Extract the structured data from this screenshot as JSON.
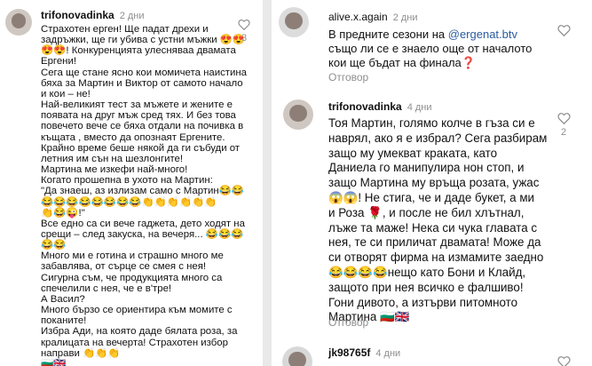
{
  "left": {
    "comment": {
      "username": "trifonovadinka",
      "time": "2 дни",
      "lines": [
        "Страхотен ерген! Ще падат дрехи и",
        "задръжки, ще ги убива с устни мъжки 😍😍",
        "😍😍! Конкуренцията улесняваа двамата",
        "Ергени!",
        "Сега ще стане ясно кои момичета наистина",
        "бяха за Мартин и Виктор от самото начало",
        "и кои – не!",
        "Най-великият тест за мъжете и жените е",
        "появата на друг мъж сред тях. И без това",
        "повечето вече се бяха отдали на почивка в",
        "къщата , вместо да опознаят Ергените.",
        "Крайно време беше някой да ги събуди от",
        "летния им сън на шезлонгите!",
        "Мартина ме изкефи най-много!",
        "Когато прошепна в ухото на Мартин:",
        "\"Да знаеш, аз излизам само с Мартин😂😂",
        "😂😂😂😂😂😂😂😂👏👏👏👏👏👏",
        "👏😂😜!\"",
        "Все едно са си вече гаджета, дето ходят на",
        "срещи – след закуска, на вечеря... 😂😂😂",
        "😂😂",
        "Много ми е готина и страшно много ме",
        "забавлява, от сърце се смея с нея!",
        "Сигурна съм, че продукцията много са",
        "спечелили с нея, че е в'тре!",
        "А Васил?",
        "Много бързо се ориентира към момите с",
        "поканите!",
        "Избра Ади, на която даде бялата роза, за",
        "кралицата на вечерта! Страхотен избор",
        "направи 👏👏👏",
        "🇧🇬🇬🇧"
      ],
      "likes": "3"
    }
  },
  "right": {
    "comment1": {
      "username": "alive.x.again",
      "time": "2 дни",
      "lines": [
        "В предните сезони на @ergenat.btv",
        "също ли се е знаело още от началото",
        "кои ще бъдат на финала❓"
      ],
      "mention": "@ergenat.btv",
      "reply": "Отговор"
    },
    "comment2": {
      "username": "trifonovadinka",
      "time": "4 дни",
      "lines": [
        "Тоя Мартин, голямо колче в гъза си е",
        "наврял, ако я е избрал? Сега разбирам",
        "защо му умекват краката, като",
        "Даниела го манипулира нон стоп, и",
        "защо Мартина му връща розата, ужас",
        "😱😱! Не стига, че и даде букет, а ми",
        "и Роза 🌹, и после не бил хлътнал,",
        "лъже та маже! Нека си чука главата с",
        "нея, те си приличат двамата! Може да",
        "си отворят фирма на измамите заедно",
        "😂😂😂😂нещо като Бони и Клайд,",
        "защото при нея всичко е фалшиво!",
        "Гони дивото, а изтърви питомното",
        "Мартина 🇧🇬🇬🇧"
      ],
      "likes": "2",
      "reply": "Отговор"
    },
    "comment3": {
      "username": "jk98765f",
      "time": "4 дни"
    }
  }
}
